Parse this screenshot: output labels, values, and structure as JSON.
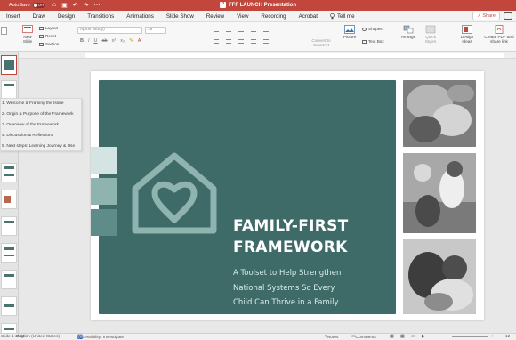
{
  "titlebar": {
    "autosave_label": "AutoSave",
    "autosave_state": "OFF",
    "document_title": "FFF LAUNCH Presentation",
    "app_badge": "P"
  },
  "menu": {
    "tabs": [
      "Insert",
      "Draw",
      "Design",
      "Transitions",
      "Animations",
      "Slide Show",
      "Review",
      "View",
      "Recording",
      "Acrobat"
    ],
    "tell_me": "Tell me",
    "share": "Share"
  },
  "ribbon": {
    "new_slide": "New Slide",
    "layout": "Layout",
    "reset": "Reset",
    "section": "Section",
    "font_name": "Aptos (Body)",
    "font_size": "18",
    "convert_smartart": "Convert to SmartArt",
    "picture": "Picture",
    "shapes": "Shapes",
    "text_box": "Text Box",
    "arrange": "Arrange",
    "quick_styles": "Quick Styles",
    "design_ideas": "Design Ideas",
    "create_pdf": "Create PDF and share link"
  },
  "agenda": {
    "items": [
      "1. Welcome & Framing the Issue",
      "2. Origin & Purpose of the Framework",
      "3. Overview of the Framework",
      "4. Discussion & Reflections",
      "5. Next steps: Learning Journey & Use"
    ]
  },
  "slide": {
    "title_line1": "FAMILY-FIRST",
    "title_line2": "FRAMEWORK",
    "subtitle_line1": "A Toolset to Help Strengthen",
    "subtitle_line2": "National Systems So Every",
    "subtitle_line3": "Child Can Thrive in a Family",
    "panel_color": "#3e6a68",
    "accent_colors": [
      "#d3e4e2",
      "#8fb3af",
      "#5e8c88"
    ]
  },
  "status": {
    "slide_counter": "Slide 1 of 21",
    "language": "English (United States)",
    "accessibility": "Accessibility: Investigate",
    "notes": "Notes",
    "comments": "Comments",
    "zoom": "12"
  },
  "colors": {
    "titlebar": "#c1463b",
    "slide_panel": "#3e6a68"
  }
}
